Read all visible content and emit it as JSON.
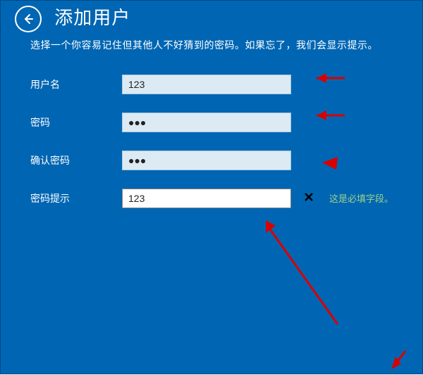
{
  "header": {
    "title": "添加用户",
    "subtitle": "选择一个你容易记住但其他人不好猜到的密码。如果忘了，我们会显示提示。"
  },
  "form": {
    "username": {
      "label": "用户名",
      "value": "123"
    },
    "password": {
      "label": "密码",
      "value": "●●●"
    },
    "confirm": {
      "label": "确认密码",
      "value": "●●●"
    },
    "hint": {
      "label": "密码提示",
      "value": "123",
      "required_msg": "这是必填字段。"
    }
  },
  "icons": {
    "back": "back-arrow",
    "clear": "close-x"
  },
  "colors": {
    "bg": "#0066b3",
    "input_bg": "#dceaf3",
    "input_focus_bg": "#ffffff",
    "required_msg": "#9bd28a",
    "annotation_arrow": "#d80000"
  }
}
